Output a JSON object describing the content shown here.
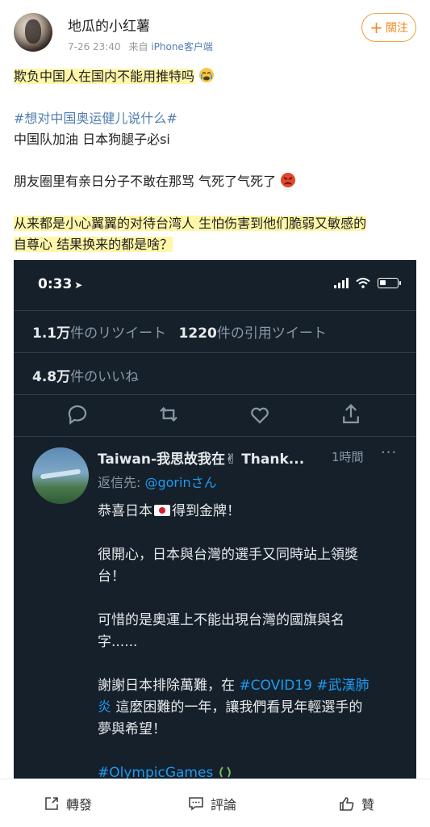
{
  "header": {
    "username": "地瓜的小红薯",
    "timestamp": "7-26 23:40",
    "source_prefix": "来自",
    "device": "iPhone客户端",
    "follow_label": "關注"
  },
  "post": {
    "line1": "欺负中国人在国内不能用推特吗",
    "topic": "#想对中国奥运健儿说什么#",
    "line3": "中国队加油 日本狗腿子必si",
    "line4": "朋友圈里有亲日分子不敢在那骂 气死了气死了",
    "line5": "从来都是小心翼翼的对待台湾人 生怕伤害到他们脆弱又敏感的",
    "line6": "自尊心 结果换来的都是啥？"
  },
  "screenshot": {
    "status_time": "0:33",
    "stats": {
      "retweets_value": "1.1万",
      "retweets_label": "件のリツイート",
      "quotes_value": "1220",
      "quotes_label": "件の引用ツイート",
      "likes_value": "4.8万",
      "likes_label": "件のいいね"
    },
    "reply": {
      "name": "Taiwan-我思故我在✌ Thank...",
      "time": "1時間",
      "more": "···",
      "reply_to_prefix": "返信先: ",
      "reply_to_handle": "@gorinさん",
      "p1_before": "恭喜日本",
      "p1_after": "得到金牌！",
      "p2a": "很開心，日本與台灣的選手又同時站上領獎",
      "p2b": "台！",
      "p3a": "可惜的是奧運上不能出現台灣的國旗與名",
      "p3b": "字......",
      "p4a_before": "謝謝日本排除萬難，在 ",
      "p4a_link1": "#COVID19",
      "p4a_space": " ",
      "p4a_link2": "#武漢肺",
      "p4b_link": "炎",
      "p4b_after": " 這麼困難的一年，讓我們看見年輕選手的",
      "p4c": "夢與希望！",
      "hashtag": "#OlympicGames"
    }
  },
  "toolbar": {
    "repost": "轉發",
    "comment": "評論",
    "like": "贊"
  },
  "colors": {
    "accent_orange": "#f08a1c",
    "link_blue": "#507daf",
    "highlight": "#fff6a8",
    "twitter_bg": "#15202b",
    "twitter_blue": "#1d9bf0"
  }
}
